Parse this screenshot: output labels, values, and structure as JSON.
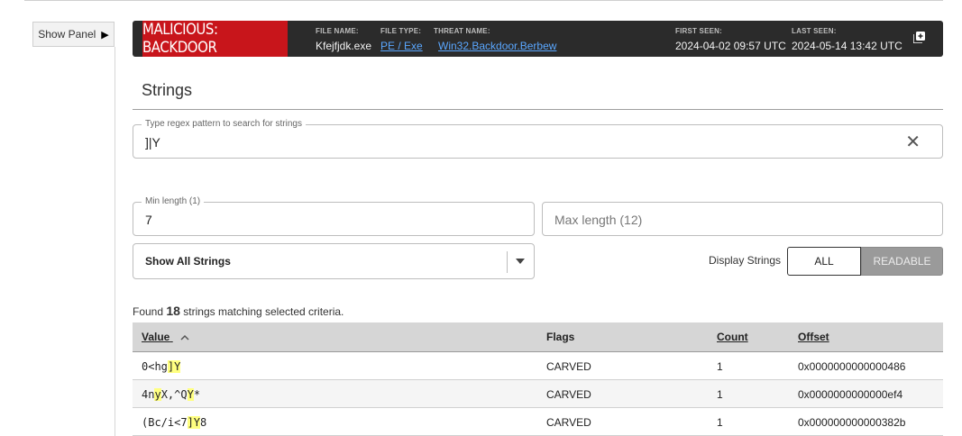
{
  "panel": {
    "show_label": "Show Panel"
  },
  "banner": {
    "verdict": "MALICIOUS: BACKDOOR",
    "file_name_label": "FILE NAME:",
    "file_name": "Kfejfjdk.exe",
    "file_type_label": "FILE TYPE:",
    "file_type": "PE / Exe",
    "threat_label": "THREAT NAME:",
    "threat": "Win32.Backdoor.Berbew",
    "first_seen_label": "FIRST SEEN:",
    "first_seen": "2024-04-02 09:57 UTC",
    "last_seen_label": "LAST SEEN:",
    "last_seen": "2024-05-14 13:42 UTC",
    "colors": {
      "verdict_bg": "#c8151b",
      "bar_bg": "#2b2b2b",
      "link": "#5aa7ff"
    }
  },
  "section": {
    "title": "Strings"
  },
  "search": {
    "label": "Type regex pattern to search for strings",
    "value": "]|Y"
  },
  "min_length": {
    "label": "Min length (1)",
    "value": "7"
  },
  "max_length": {
    "placeholder": "Max length (12)"
  },
  "filter_select": {
    "selected": "Show All Strings"
  },
  "display": {
    "label": "Display Strings",
    "all": "ALL",
    "readable": "READABLE",
    "active": "ALL"
  },
  "results": {
    "prefix": "Found",
    "count": "18",
    "suffix": "strings matching selected criteria."
  },
  "table": {
    "headers": {
      "value": "Value",
      "flags": "Flags",
      "count": "Count",
      "offset": "Offset"
    },
    "rows": [
      {
        "value_parts": [
          "0<hg",
          "]Y",
          ""
        ],
        "flags": "CARVED",
        "count": "1",
        "offset": "0x0000000000000486"
      },
      {
        "value_parts": [
          "4n",
          "y",
          "X,^Q",
          "Y",
          "*"
        ],
        "flags": "CARVED",
        "count": "1",
        "offset": "0x0000000000000ef4"
      },
      {
        "value_parts": [
          "(Bc/i<7",
          "]Y",
          "8"
        ],
        "flags": "CARVED",
        "count": "1",
        "offset": "0x000000000000382b"
      }
    ],
    "highlight_color": "#ffff80"
  }
}
